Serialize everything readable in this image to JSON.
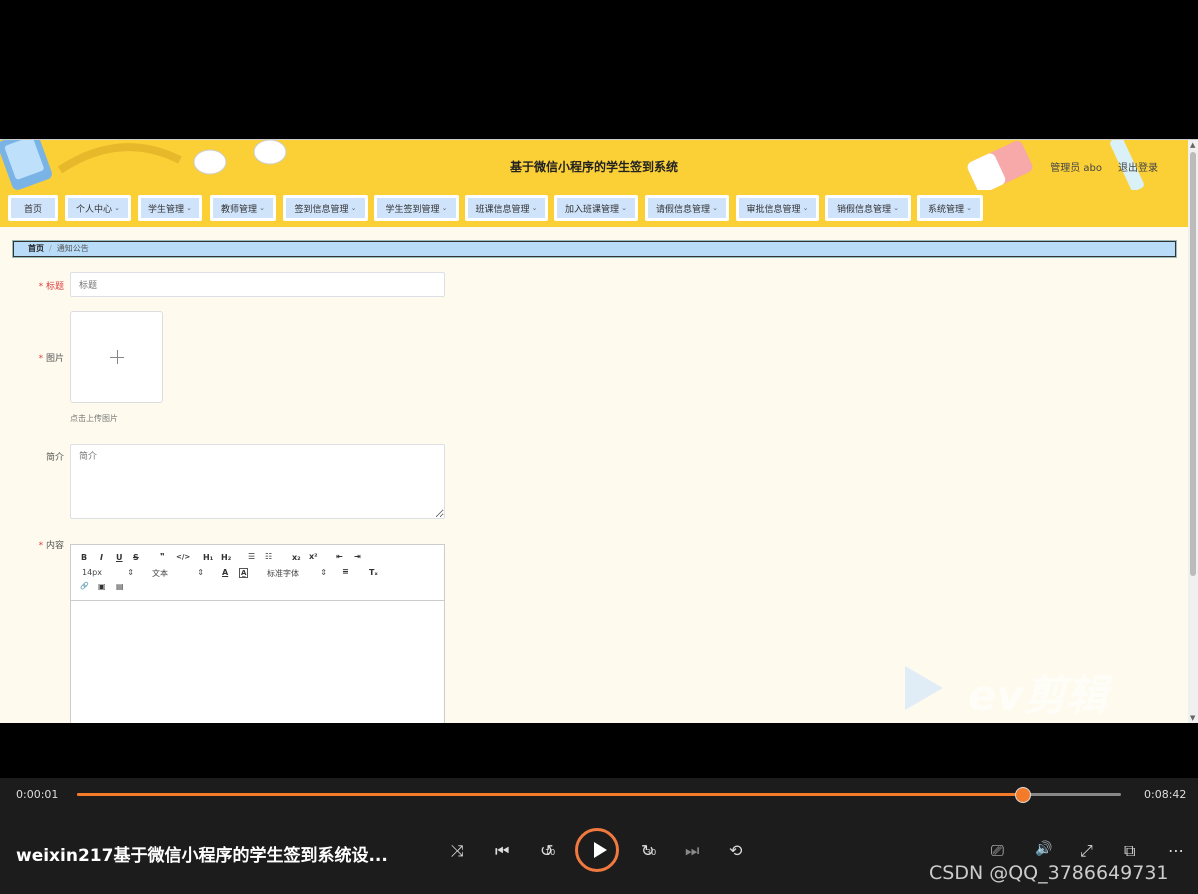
{
  "header": {
    "title": "基于微信小程序的学生签到系统",
    "admin": "管理员 abo",
    "logout": "退出登录"
  },
  "nav": {
    "items": [
      {
        "label": "首页",
        "dropdown": false
      },
      {
        "label": "个人中心",
        "dropdown": true
      },
      {
        "label": "学生管理",
        "dropdown": true
      },
      {
        "label": "教师管理",
        "dropdown": true
      },
      {
        "label": "签到信息管理",
        "dropdown": true
      },
      {
        "label": "学生签到管理",
        "dropdown": true
      },
      {
        "label": "班课信息管理",
        "dropdown": true
      },
      {
        "label": "加入班课管理",
        "dropdown": true
      },
      {
        "label": "请假信息管理",
        "dropdown": true
      },
      {
        "label": "审批信息管理",
        "dropdown": true
      },
      {
        "label": "销假信息管理",
        "dropdown": true
      },
      {
        "label": "系统管理",
        "dropdown": true
      }
    ]
  },
  "breadcrumb": {
    "home": "首页",
    "sep": "/",
    "current": "通知公告"
  },
  "form": {
    "title_label": "标题",
    "title_placeholder": "标题",
    "image_label": "图片",
    "image_hint": "点击上传图片",
    "intro_label": "简介",
    "intro_placeholder": "简介",
    "content_label": "内容",
    "required_mark": "*"
  },
  "editor": {
    "row1": [
      "B",
      "I",
      "U",
      "S",
      "❞",
      "</>",
      "H₁",
      "H₂",
      "☰",
      "☷",
      "x₂",
      "x²",
      "⇤",
      "⇥"
    ],
    "font_size": "14px",
    "text_style": "文本",
    "font_family": "标准字体",
    "row2_icons": [
      "A",
      "A̲",
      "≡",
      "Tₓ"
    ],
    "row3": [
      "🔗",
      "▣",
      "▤"
    ]
  },
  "player": {
    "elapsed": "0:00:01",
    "duration": "0:08:42",
    "progress": 0.905,
    "video_title": "weixin217基于微信小程序的学生签到系统设...",
    "controls": [
      "shuffle-icon",
      "previous-icon",
      "rewind-10-icon",
      "play-icon",
      "forward-30-icon",
      "next-icon",
      "repeat-icon",
      "subtitles-icon",
      "volume-icon",
      "fullscreen-icon",
      "miniplayer-icon",
      "more-icon"
    ],
    "icon_glyphs": {
      "shuffle": "⤨",
      "prev": "⏮",
      "rew": "↺",
      "fwd": "↻",
      "rew_num": "10",
      "fwd_num": "30",
      "next": "⏭",
      "repeat": "⟲",
      "sub": "⎚",
      "vol": "🔊",
      "full": "⤢",
      "mini": "⧉",
      "more": "⋯"
    }
  },
  "watermarks": {
    "editor_brand": "ev剪辑",
    "csdn": "CSDN @QQ_3786649731"
  },
  "colors": {
    "header_bg": "#fbd037",
    "nav_item_bg": "#cfe3fb",
    "page_bg": "#fefbee",
    "accent": "#f47b2a",
    "breadcrumb_bg": "#b9dcf8"
  }
}
